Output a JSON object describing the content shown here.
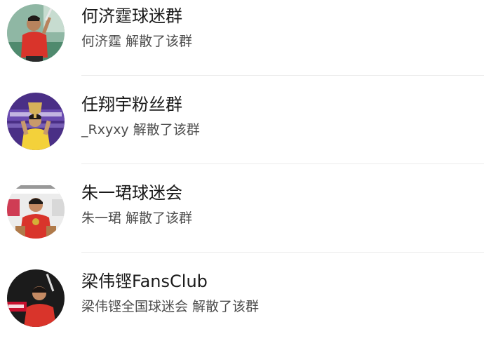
{
  "groups": [
    {
      "name": "何济霆球迷群",
      "status": "何济霆 解散了该群",
      "avatar_icon": "player-photo-avatar"
    },
    {
      "name": "任翔宇粉丝群",
      "status": "_Rxyxy 解散了该群",
      "avatar_icon": "trophy-photo-avatar"
    },
    {
      "name": "朱一珺球迷会",
      "status": "朱一珺 解散了该群",
      "avatar_icon": "player-photo-avatar"
    },
    {
      "name": "梁伟铿FansClub",
      "status": "梁伟铿全国球迷会 解散了该群",
      "avatar_icon": "player-photo-avatar"
    }
  ],
  "colors": {
    "name_text": "#1a1a1a",
    "status_text": "#4d4d4d",
    "divider": "#ececec",
    "jersey_red": "#d9342b"
  }
}
